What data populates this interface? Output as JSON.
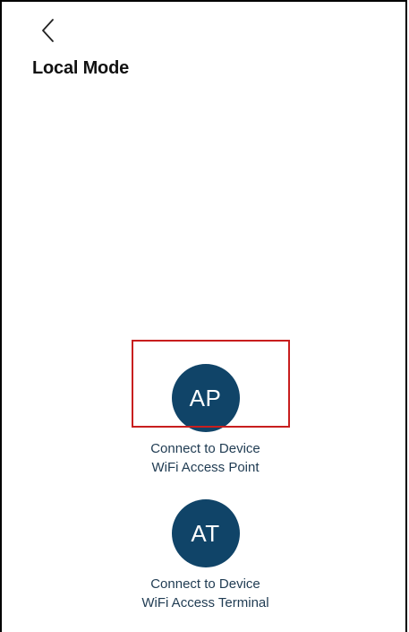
{
  "header": {
    "back_icon": "chevron-left-icon",
    "title": "Local Mode"
  },
  "options": [
    {
      "badge": "AP",
      "label_line1": "Connect to Device",
      "label_line2": "WiFi Access Point"
    },
    {
      "badge": "AT",
      "label_line1": "Connect to Device",
      "label_line2": "WiFi Access Terminal"
    }
  ],
  "colors": {
    "badge_bg": "#104468",
    "badge_text": "#ffffff",
    "label_text": "#1f3b52",
    "highlight": "#c81e1e"
  }
}
